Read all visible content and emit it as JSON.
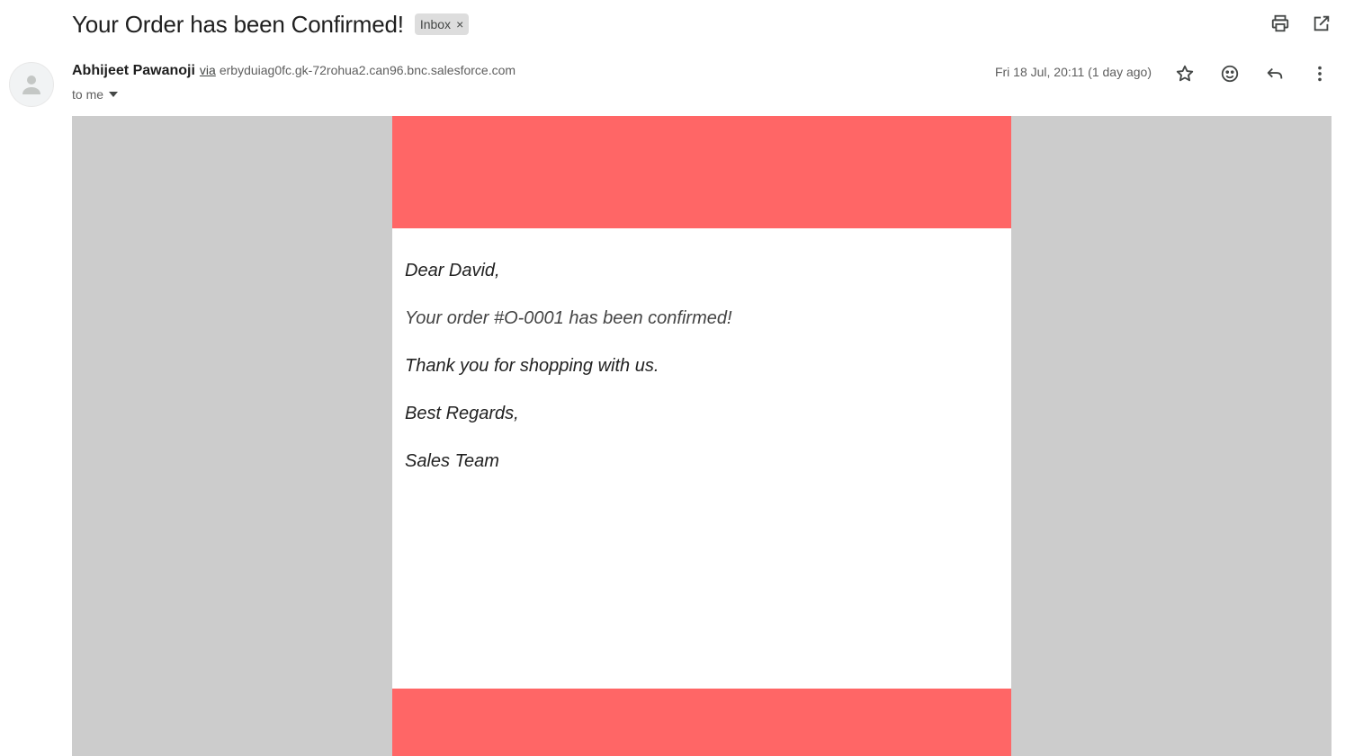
{
  "subject": "Your Order has been Confirmed!",
  "label": {
    "text": "Inbox",
    "remove_symbol": "×"
  },
  "top_actions": {
    "print_icon": "printer-icon",
    "open_icon": "open-in-new-window-icon"
  },
  "sender": {
    "name": "Abhijeet Pawanoji",
    "via_label": "via",
    "via_domain": "erbyduiag0fc.gk-72rohua2.can96.bnc.salesforce.com",
    "to_text": "to me",
    "date": "Fri 18 Jul, 20:11 (1 day ago)"
  },
  "message_actions": [
    "star-icon",
    "emoji-reaction-icon",
    "reply-icon",
    "more-options-icon"
  ],
  "email": {
    "greeting": "Dear David,",
    "line1": "Your order #O-0001 has been confirmed!",
    "line2": "Thank you for shopping with us.",
    "closing": "Best Regards,",
    "signature": "Sales Team"
  },
  "colors": {
    "banner": "#ff6666",
    "frame_background": "#cccccc",
    "chip_background": "#dddddd"
  }
}
